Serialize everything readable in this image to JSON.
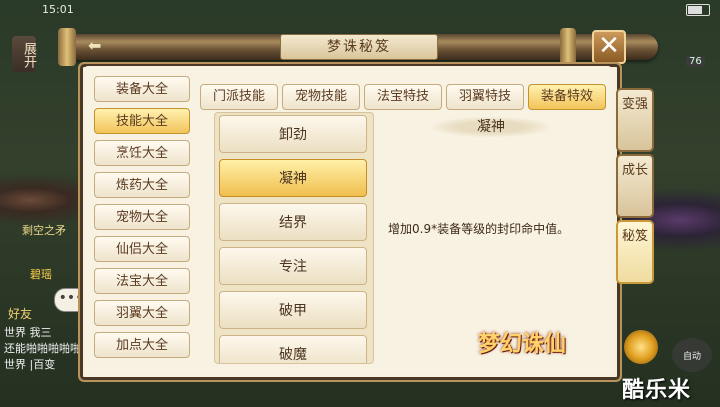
{
  "status": {
    "time": "15:01"
  },
  "hud": {
    "expand_label": "展开",
    "char_name_1": "剩空之矛",
    "char_name_2": "碧瑶",
    "friend_label": "好友",
    "chat_lines": [
      "世界 我三",
      "还能啪啪啪啪啪",
      "世界 |百变"
    ],
    "level_badge": "76"
  },
  "dialog": {
    "title": "梦诛秘笈",
    "categories": [
      "装备大全",
      "技能大全",
      "烹饪大全",
      "炼药大全",
      "宠物大全",
      "仙侣大全",
      "法宝大全",
      "羽翼大全",
      "加点大全"
    ],
    "active_category": 1,
    "tabs": [
      "门派技能",
      "宠物技能",
      "法宝特技",
      "羽翼特技",
      "装备特效"
    ],
    "active_tab": 4,
    "skills": [
      "卸劲",
      "凝神",
      "结界",
      "专注",
      "破甲",
      "破魔"
    ],
    "active_skill": 1,
    "detail": {
      "name": "凝神",
      "description": "增加0.9*装备等级的封印命中值。"
    }
  },
  "side_tabs": [
    {
      "label": "变强",
      "active": false
    },
    {
      "label": "成长",
      "active": false
    },
    {
      "label": "秘笈",
      "active": true
    }
  ],
  "footer": {
    "logo_text": "梦幻诛仙",
    "auto_label": "自动",
    "watermark": "酷乐米"
  }
}
